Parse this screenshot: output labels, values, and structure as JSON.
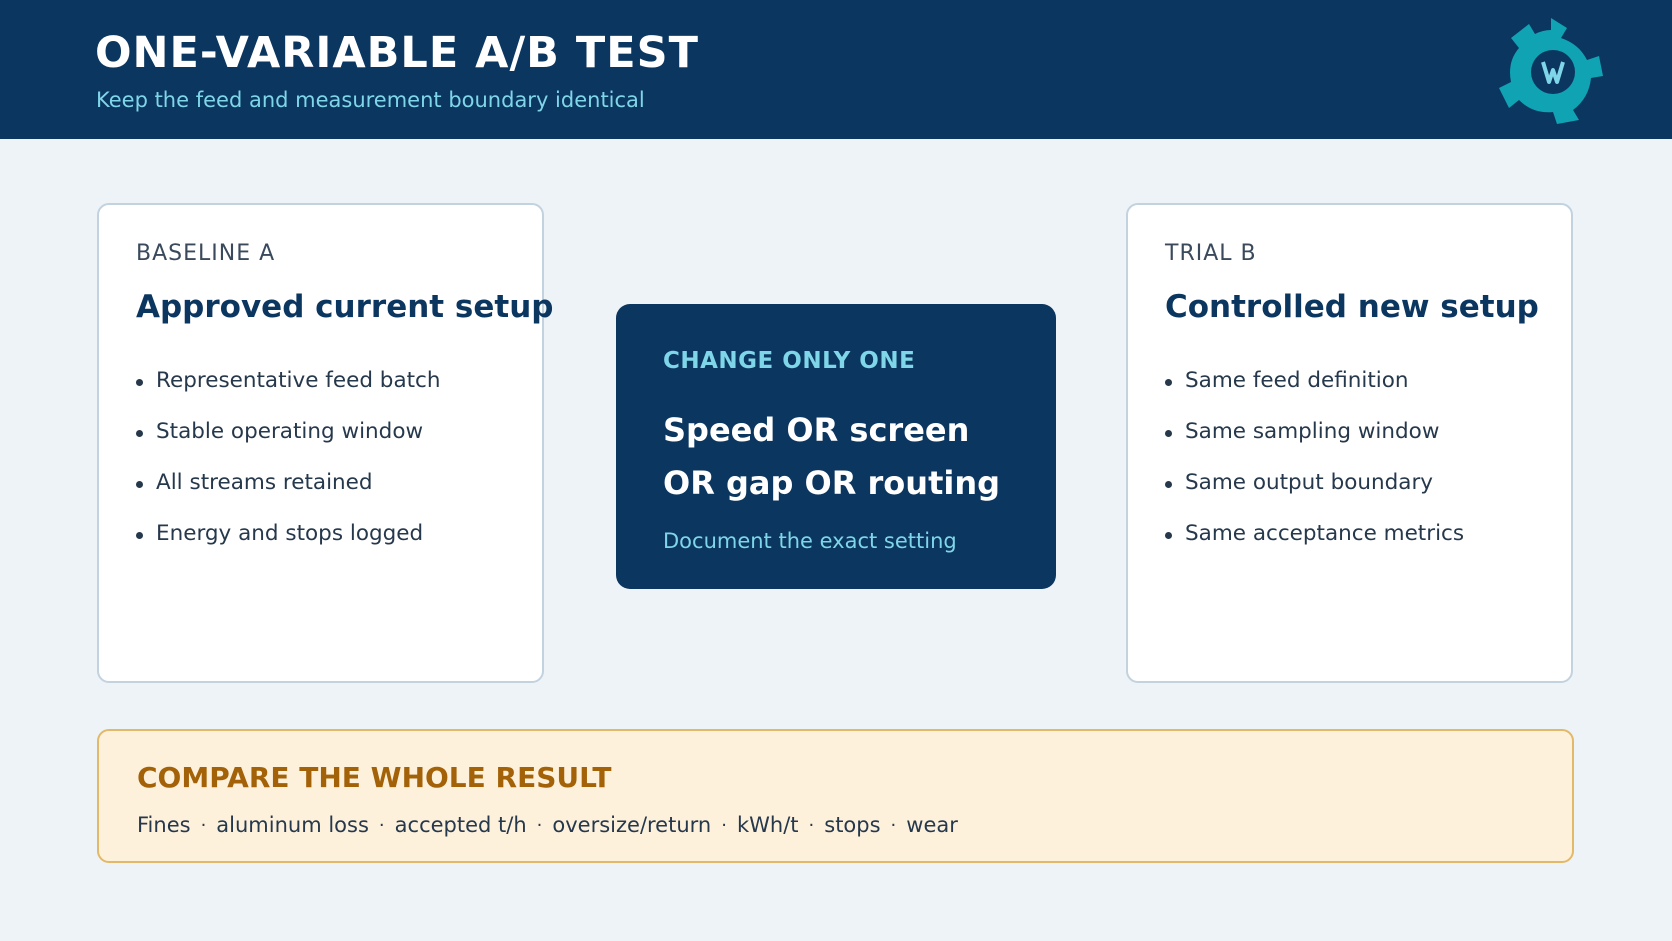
{
  "header": {
    "title": "ONE-VARIABLE A/B TEST",
    "subtitle": "Keep the feed and measurement boundary identical",
    "logo_icon": "gear-logo-icon",
    "logo_colors": {
      "gear": "#10a3b3",
      "core": "#0b365f",
      "mark": "#7fd6e8"
    }
  },
  "baseline": {
    "label": "BASELINE A",
    "heading": "Approved current setup",
    "items": [
      "Representative feed batch",
      "Stable operating window",
      "All streams retained",
      "Energy and stops logged"
    ]
  },
  "center": {
    "label": "CHANGE ONLY ONE",
    "line1": "Speed OR screen",
    "line2": "OR gap OR routing",
    "note": "Document the exact setting"
  },
  "trial": {
    "label": "TRIAL B",
    "heading": "Controlled new setup",
    "items": [
      "Same feed definition",
      "Same sampling window",
      "Same output boundary",
      "Same acceptance metrics"
    ]
  },
  "compare": {
    "title": "COMPARE THE WHOLE RESULT",
    "metrics": [
      "Fines",
      "aluminum loss",
      "accepted t/h",
      "oversize/return",
      "kWh/t",
      "stops",
      "wear"
    ],
    "separator": "·"
  },
  "colors": {
    "navy": "#0b365f",
    "cyan": "#7fd6e8",
    "amber": "#a46208",
    "amber_bg": "#fdf1dc"
  }
}
